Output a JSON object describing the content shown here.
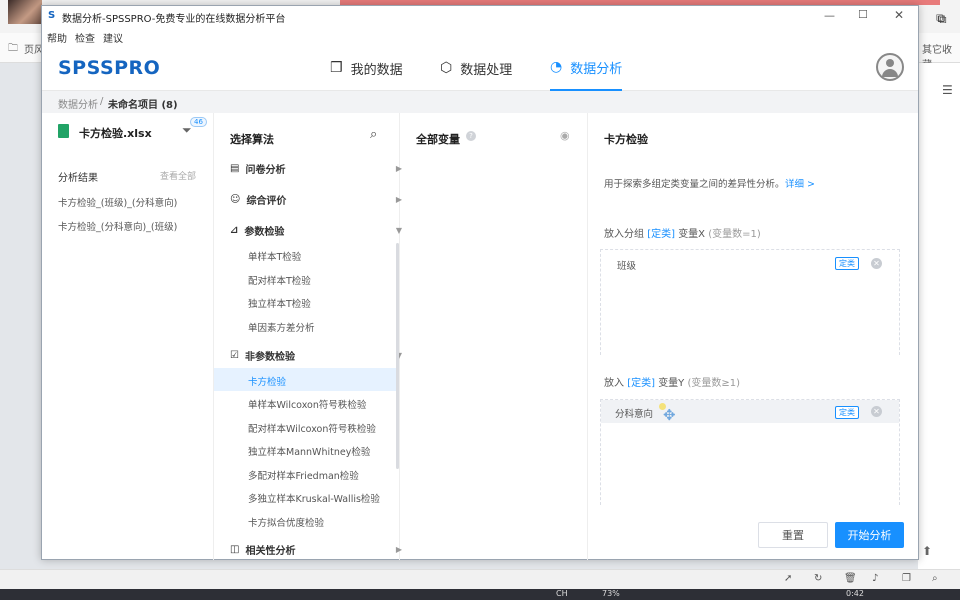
{
  "browser": {
    "bookmark_label": "页风",
    "other_bookmarks": "其它收藏",
    "zoom": "73%",
    "time": "0:42",
    "lang": "CH"
  },
  "window": {
    "title": "数据分析-SPSSPRO-免费专业的在线数据分析平台",
    "menu": [
      "帮助",
      "检查",
      "建议"
    ]
  },
  "header": {
    "logo": "SPSSPRO",
    "nav": [
      "我的数据",
      "数据处理",
      "数据分析"
    ]
  },
  "breadcrumb": {
    "root": "数据分析",
    "sep": "/",
    "current": "未命名项目 (8)"
  },
  "file_panel": {
    "filename": "卡方检验.xlsx",
    "badge": "46",
    "results_title": "分析结果",
    "view_all": "查看全部",
    "results": [
      "卡方检验_(班级)_(分科意向)",
      "卡方检验_(分科意向)_(班级)"
    ]
  },
  "algo_panel": {
    "title": "选择算法",
    "categories": [
      {
        "label": "问卷分析",
        "arrow": "▶"
      },
      {
        "label": "综合评价",
        "arrow": "▶"
      },
      {
        "label": "参数检验",
        "arrow": "▼"
      },
      {
        "label": "非参数检验",
        "arrow": "▼"
      },
      {
        "label": "相关性分析",
        "arrow": "▶"
      }
    ],
    "param_items": [
      "单样本T检验",
      "配对样本T检验",
      "独立样本T检验",
      "单因素方差分析"
    ],
    "nonparam_items": [
      "卡方检验",
      "单样本Wilcoxon符号秩检验",
      "配对样本Wilcoxon符号秩检验",
      "独立样本MannWhitney检验",
      "多配对样本Friedman检验",
      "多独立样本Kruskal-Wallis检验",
      "卡方拟合优度检验"
    ]
  },
  "var_panel": {
    "title": "全部变量"
  },
  "config_panel": {
    "title": "卡方检验",
    "desc": "用于探索多组定类变量之间的差异性分析。",
    "detail_link": "详细 >",
    "x_prefix": "放入分组",
    "x_type": "[定类]",
    "x_var": "变量X",
    "x_count": "(变量数=1)",
    "x_value": "班级",
    "x_tag": "定类",
    "y_prefix": "放入",
    "y_type": "[定类]",
    "y_var": "变量Y",
    "y_count": "(变量数≥1)",
    "y_value": "分科意向",
    "y_tag": "定类",
    "reset": "重置",
    "start": "开始分析"
  },
  "colors": {
    "brand": "#1565c0",
    "accent": "#1890ff"
  }
}
